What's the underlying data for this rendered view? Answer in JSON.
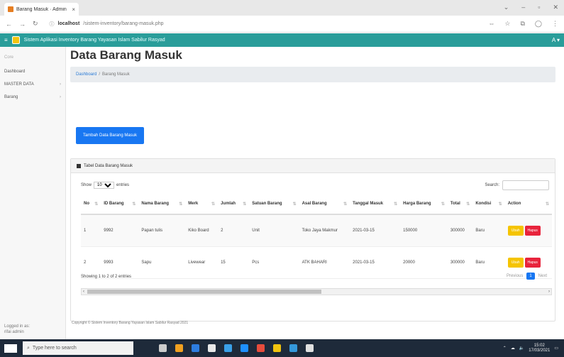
{
  "browser": {
    "tab_title": "Barang Masuk · Admin",
    "tab_close": "×",
    "url_host": "localhost",
    "url_path": "/sistem-inventory/barang-masuk.php",
    "icons": [
      "back-arrow-icon",
      "forward-arrow-icon",
      "reload-icon",
      "star-icon",
      "extensions-icon",
      "menu-icon"
    ]
  },
  "app": {
    "title": "Sistem Aplikasi Inventory Barang Yayasan Islam Sabilur Rasyad",
    "user_label": "A"
  },
  "sidebar": {
    "heading": "Core",
    "items": [
      {
        "label": "Dashboard"
      },
      {
        "label": "MASTER DATA"
      },
      {
        "label": "Barang"
      }
    ],
    "footer_line1": "Logged in as:",
    "footer_line2": "rifai admin"
  },
  "main": {
    "page_title": "Data Barang Masuk",
    "breadcrumb": {
      "link": "Dashboard",
      "sep": "/",
      "current": "Barang Masuk"
    },
    "add_button": "Tambah Data Barang Masuk",
    "card_title": "Tabel Data Barang Masuk",
    "show_label": "Show",
    "entries_value": "10",
    "entries_label": "entries",
    "search_label": "Search:",
    "columns": [
      "No",
      "ID Barang",
      "Nama Barang",
      "Merk",
      "Jumlah",
      "Satuan Barang",
      "Asal Barang",
      "Tanggal Masuk",
      "Harga Barang",
      "Total",
      "Kondisi",
      "Action"
    ],
    "rows": [
      [
        "1",
        "9992",
        "Papan tulis",
        "Kiko Board",
        "2",
        "Unit",
        "Toko Jaya Makmur",
        "2021-03-15",
        "150000",
        "300000",
        "Baru"
      ],
      [
        "2",
        "9993",
        "Sapu",
        "Livewear",
        "15",
        "Pcs",
        "ATK BAHARI",
        "2021-03-15",
        "20000",
        "300000",
        "Baru"
      ]
    ],
    "edit_label": "Ubah",
    "delete_label": "Hapus",
    "info": "Showing 1 to 2 of 2 entries",
    "pager": {
      "prev": "Previous",
      "current": "1",
      "next": "Next"
    },
    "footer": "Copyright © Sistem Inventory Barang Yayasan Islam Sabilur Rasyad 2021"
  },
  "taskbar": {
    "search_placeholder": "Type here to search",
    "time": "15:02",
    "date": "17/03/2021"
  }
}
